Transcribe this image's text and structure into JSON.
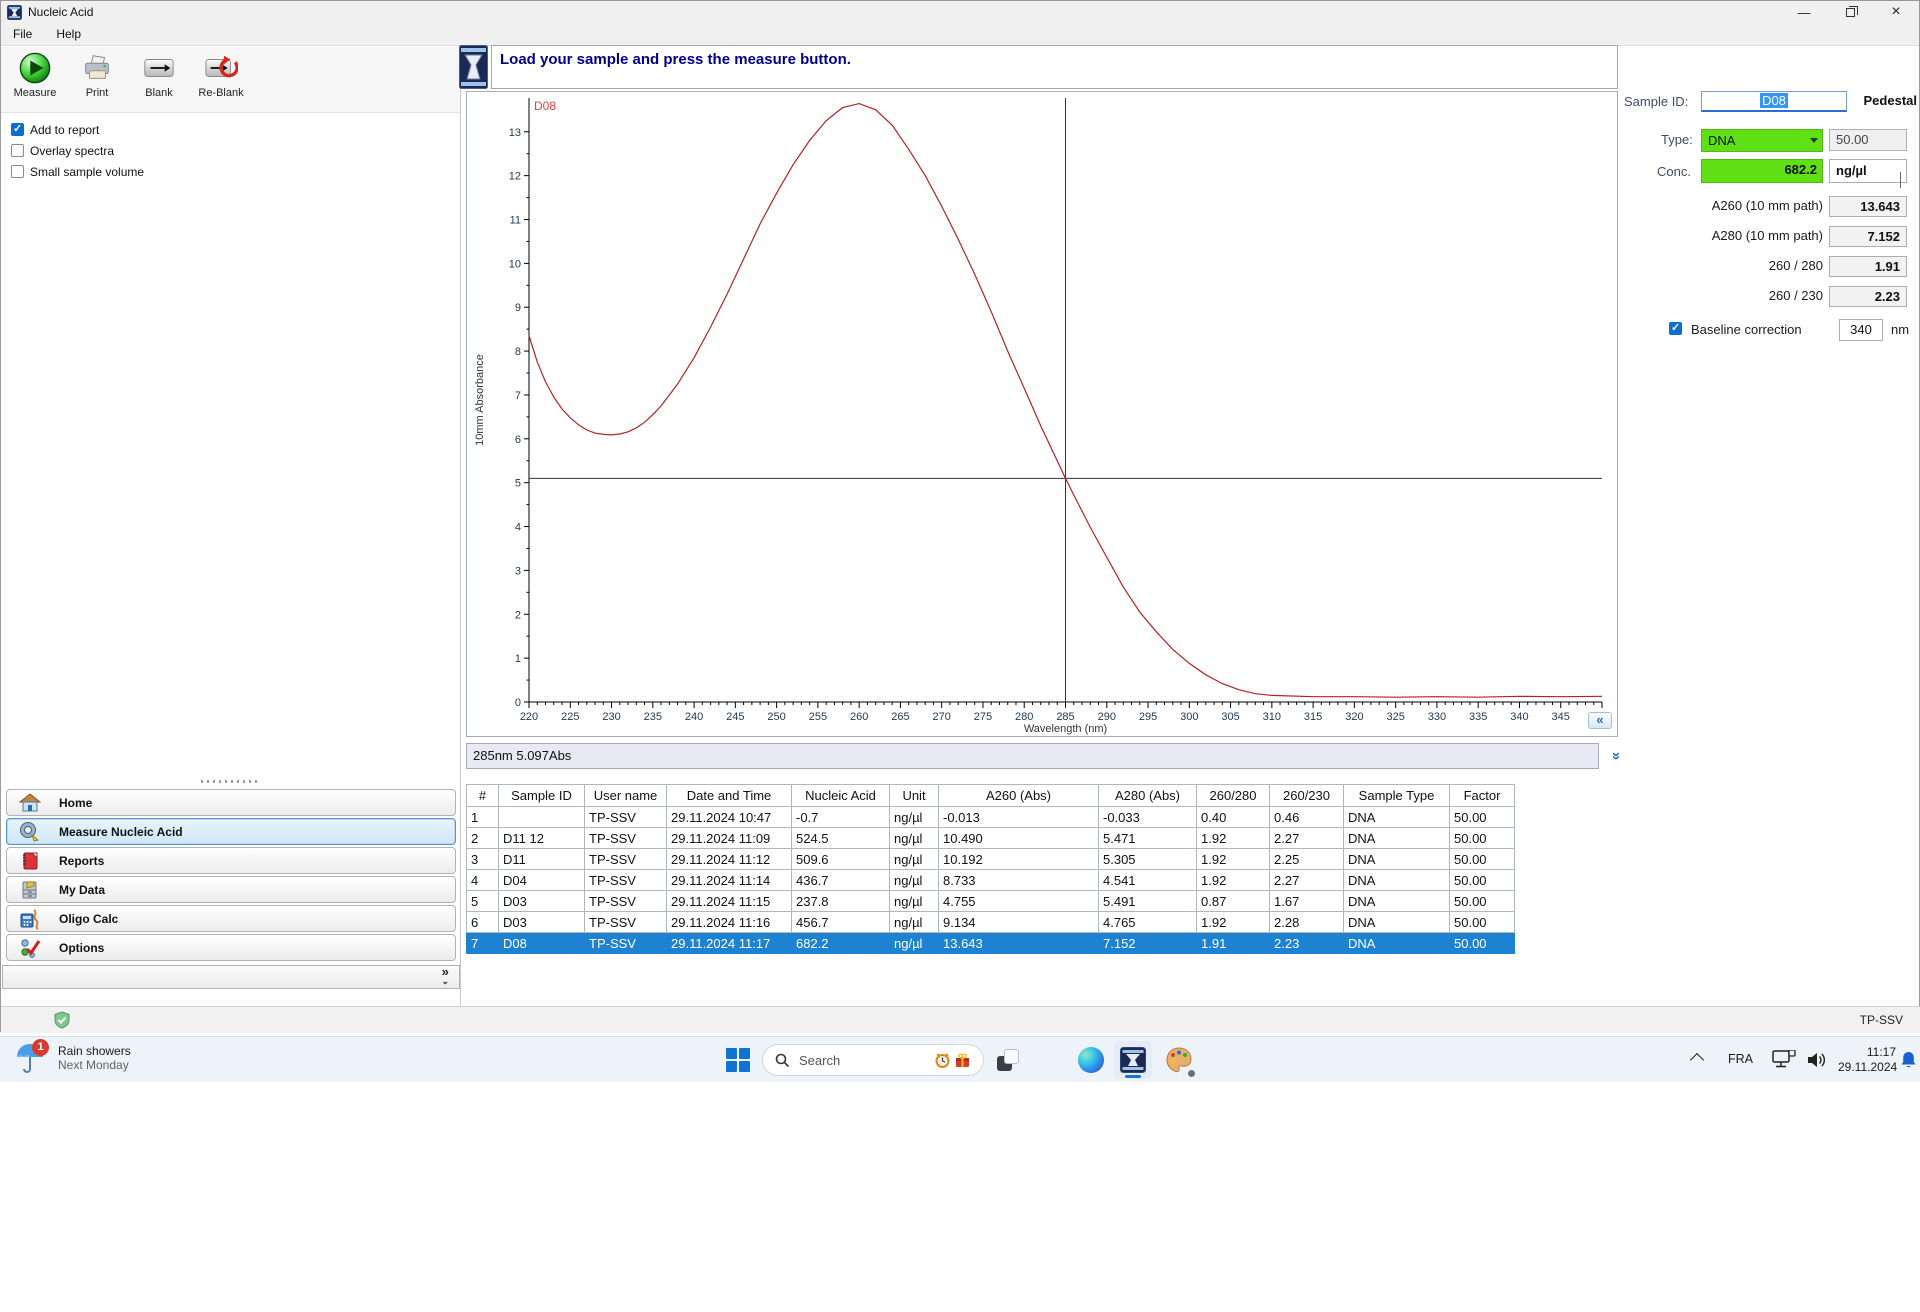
{
  "window": {
    "title": "Nucleic Acid",
    "menu": [
      "File",
      "Help"
    ],
    "status_user": "TP-SSV"
  },
  "icons": {
    "minimize": "—",
    "close": "×",
    "collapse_left": "«",
    "collapse_down": "»",
    "sidebar_expand": "»"
  },
  "toolbar": {
    "buttons": [
      {
        "label": "Measure"
      },
      {
        "label": "Print"
      },
      {
        "label": "Blank"
      },
      {
        "label": "Re-Blank"
      }
    ]
  },
  "options": [
    {
      "label": "Add to report",
      "checked": true
    },
    {
      "label": "Overlay spectra",
      "checked": false
    },
    {
      "label": "Small sample volume",
      "checked": false
    }
  ],
  "sidebar": {
    "items": [
      {
        "label": "Home"
      },
      {
        "label": "Measure Nucleic Acid",
        "active": true
      },
      {
        "label": "Reports"
      },
      {
        "label": "My Data"
      },
      {
        "label": "Oligo Calc"
      },
      {
        "label": "Options"
      }
    ]
  },
  "message": "Load your sample and press the measure button.",
  "readout": "285nm 5.097Abs",
  "chart_data": {
    "type": "line",
    "series_label": "D08",
    "xlabel": "Wavelength (nm)",
    "ylabel": "10mm Absorbance",
    "xlim": [
      220,
      350
    ],
    "xtick_step": 5,
    "ylim": [
      0,
      13.77
    ],
    "ytick_step": 1,
    "ytick_label_max": 13,
    "grid": false,
    "line_color": "#b22222",
    "label_color": "#e04343",
    "cursor": {
      "x": 285,
      "y": 5.097
    },
    "points": [
      [
        220,
        8.35
      ],
      [
        221,
        7.75
      ],
      [
        222,
        7.3
      ],
      [
        223,
        6.95
      ],
      [
        224,
        6.68
      ],
      [
        225,
        6.48
      ],
      [
        226,
        6.32
      ],
      [
        227,
        6.2
      ],
      [
        228,
        6.13
      ],
      [
        229,
        6.1
      ],
      [
        230,
        6.09
      ],
      [
        231,
        6.11
      ],
      [
        232,
        6.16
      ],
      [
        233,
        6.25
      ],
      [
        234,
        6.38
      ],
      [
        235,
        6.55
      ],
      [
        236,
        6.75
      ],
      [
        238,
        7.25
      ],
      [
        240,
        7.85
      ],
      [
        242,
        8.55
      ],
      [
        244,
        9.3
      ],
      [
        246,
        10.1
      ],
      [
        248,
        10.9
      ],
      [
        250,
        11.6
      ],
      [
        252,
        12.25
      ],
      [
        254,
        12.8
      ],
      [
        256,
        13.25
      ],
      [
        258,
        13.55
      ],
      [
        260,
        13.643
      ],
      [
        262,
        13.5
      ],
      [
        264,
        13.15
      ],
      [
        266,
        12.6
      ],
      [
        268,
        12.0
      ],
      [
        270,
        11.3
      ],
      [
        272,
        10.55
      ],
      [
        274,
        9.75
      ],
      [
        276,
        8.9
      ],
      [
        278,
        8.0
      ],
      [
        280,
        7.152
      ],
      [
        282,
        6.3
      ],
      [
        284,
        5.5
      ],
      [
        285,
        5.097
      ],
      [
        286,
        4.72
      ],
      [
        288,
        3.98
      ],
      [
        290,
        3.3
      ],
      [
        292,
        2.62
      ],
      [
        294,
        2.05
      ],
      [
        296,
        1.6
      ],
      [
        298,
        1.2
      ],
      [
        300,
        0.88
      ],
      [
        302,
        0.62
      ],
      [
        304,
        0.42
      ],
      [
        306,
        0.28
      ],
      [
        308,
        0.19
      ],
      [
        310,
        0.15
      ],
      [
        315,
        0.12
      ],
      [
        320,
        0.12
      ],
      [
        325,
        0.11
      ],
      [
        330,
        0.12
      ],
      [
        335,
        0.11
      ],
      [
        340,
        0.13
      ],
      [
        345,
        0.12
      ],
      [
        350,
        0.13
      ]
    ]
  },
  "panel": {
    "sample_id_label": "Sample ID:",
    "sample_id": "D08",
    "mode": "Pedestal",
    "type_label": "Type:",
    "type_value": "DNA",
    "type_factor": "50.00",
    "conc_label": "Conc.",
    "conc_value": "682.2",
    "conc_unit": "ng/µl",
    "rows": [
      {
        "label": "A260 (10 mm path)",
        "value": "13.643"
      },
      {
        "label": "A280 (10 mm path)",
        "value": "7.152"
      },
      {
        "label": "260 / 280",
        "value": "1.91"
      },
      {
        "label": "260 / 230",
        "value": "2.23"
      }
    ],
    "baseline_label": "Baseline correction",
    "baseline_checked": true,
    "baseline_value": "340",
    "baseline_unit": "nm"
  },
  "table": {
    "columns": [
      "#",
      "Sample ID",
      "User name",
      "Date and Time",
      "Nucleic Acid",
      "Unit",
      "A260 (Abs)",
      "A280 (Abs)",
      "260/280",
      "260/230",
      "Sample Type",
      "Factor"
    ],
    "rows": [
      [
        "1",
        "",
        "TP-SSV",
        "29.11.2024 10:47",
        "-0.7",
        "ng/µl",
        "-0.013",
        "-0.033",
        "0.40",
        "0.46",
        "DNA",
        "50.00"
      ],
      [
        "2",
        "D11 12",
        "TP-SSV",
        "29.11.2024 11:09",
        "524.5",
        "ng/µl",
        "10.490",
        "5.471",
        "1.92",
        "2.27",
        "DNA",
        "50.00"
      ],
      [
        "3",
        "D11",
        "TP-SSV",
        "29.11.2024 11:12",
        "509.6",
        "ng/µl",
        "10.192",
        "5.305",
        "1.92",
        "2.25",
        "DNA",
        "50.00"
      ],
      [
        "4",
        "D04",
        "TP-SSV",
        "29.11.2024 11:14",
        "436.7",
        "ng/µl",
        "8.733",
        "4.541",
        "1.92",
        "2.27",
        "DNA",
        "50.00"
      ],
      [
        "5",
        "D03",
        "TP-SSV",
        "29.11.2024 11:15",
        "237.8",
        "ng/µl",
        "4.755",
        "5.491",
        "0.87",
        "1.67",
        "DNA",
        "50.00"
      ],
      [
        "6",
        "D03",
        "TP-SSV",
        "29.11.2024 11:16",
        "456.7",
        "ng/µl",
        "9.134",
        "4.765",
        "1.92",
        "2.28",
        "DNA",
        "50.00"
      ],
      [
        "7",
        "D08",
        "TP-SSV",
        "29.11.2024 11:17",
        "682.2",
        "ng/µl",
        "13.643",
        "7.152",
        "1.91",
        "2.23",
        "DNA",
        "50.00"
      ]
    ],
    "selected_index": 6
  },
  "taskbar": {
    "weather_badge": "1",
    "weather_line1": "Rain showers",
    "weather_line2": "Next Monday",
    "search_placeholder": "Search",
    "language": "FRA",
    "time": "11:17",
    "date": "29.11.2024"
  }
}
